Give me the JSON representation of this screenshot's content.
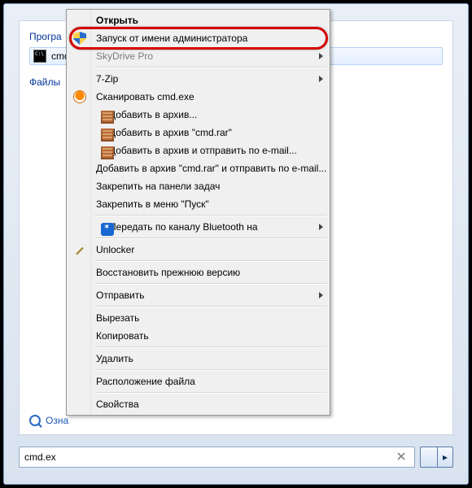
{
  "panel": {
    "programs_label": "Програ",
    "cmd_label": "cmd",
    "files_label": "Файлы",
    "see_more": "Озна"
  },
  "search": {
    "value": "cmd.ex"
  },
  "shutdown": {
    "arrow": "▸"
  },
  "menu": {
    "section_top": [
      {
        "key": "open",
        "label": "Открыть",
        "bold": true
      },
      {
        "key": "runas",
        "label": "Запуск от имени администратора",
        "icon": "shield"
      },
      {
        "key": "skydrive",
        "label": "SkyDrive Pro",
        "disabled": true,
        "submenu": true
      }
    ],
    "section_tools": [
      {
        "key": "7zip",
        "label": "7-Zip",
        "submenu": true
      },
      {
        "key": "scan",
        "label": "Сканировать cmd.exe",
        "icon": "av"
      },
      {
        "key": "arch",
        "label": "Добавить в архив...",
        "icon": "rar"
      },
      {
        "key": "arch_cmd",
        "label": "Добавить в архив \"cmd.rar\"",
        "icon": "rar"
      },
      {
        "key": "arch_mail",
        "label": "Добавить в архив и отправить по e-mail...",
        "icon": "rar"
      },
      {
        "key": "arch_cmd_mail",
        "label": "Добавить в архив \"cmd.rar\" и отправить по e-mail...",
        "icon": "rar"
      },
      {
        "key": "pin_taskbar",
        "label": "Закрепить на панели задач"
      },
      {
        "key": "pin_start",
        "label": "Закрепить в меню \"Пуск\""
      }
    ],
    "section_share": [
      {
        "key": "bt",
        "label": "Передать по каналу Bluetooth на",
        "icon": "bt",
        "submenu": true
      }
    ],
    "section_unlocker": [
      {
        "key": "unlocker",
        "label": "Unlocker",
        "icon": "wand"
      }
    ],
    "section_restore": [
      {
        "key": "restore",
        "label": "Восстановить прежнюю версию"
      }
    ],
    "section_send": [
      {
        "key": "sendto",
        "label": "Отправить",
        "submenu": true
      }
    ],
    "section_clipboard": [
      {
        "key": "cut",
        "label": "Вырезать"
      },
      {
        "key": "copy",
        "label": "Копировать"
      }
    ],
    "section_delete": [
      {
        "key": "delete",
        "label": "Удалить"
      }
    ],
    "section_location": [
      {
        "key": "openloc",
        "label": "Расположение файла"
      }
    ],
    "section_props": [
      {
        "key": "props",
        "label": "Свойства"
      }
    ]
  }
}
